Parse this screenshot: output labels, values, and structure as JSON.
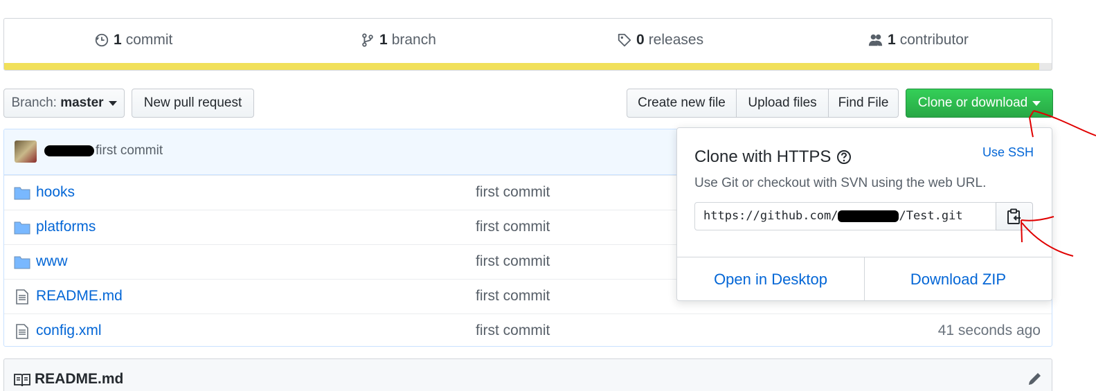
{
  "summary": {
    "commits": {
      "count": "1",
      "label": "commit"
    },
    "branches": {
      "count": "1",
      "label": "branch"
    },
    "releases": {
      "count": "0",
      "label": "releases"
    },
    "contributors": {
      "count": "1",
      "label": "contributor"
    },
    "language_color": "#f1e05a"
  },
  "toolbar": {
    "branch_prefix": "Branch:",
    "branch_name": "master",
    "new_pull_request": "New pull request",
    "create_new_file": "Create new file",
    "upload_files": "Upload files",
    "find_file": "Find File",
    "clone_or_download": "Clone or download"
  },
  "latest_commit": {
    "message": "first commit"
  },
  "files": [
    {
      "name": "hooks",
      "type": "folder",
      "message": "first commit",
      "age": ""
    },
    {
      "name": "platforms",
      "type": "folder",
      "message": "first commit",
      "age": ""
    },
    {
      "name": "www",
      "type": "folder",
      "message": "first commit",
      "age": ""
    },
    {
      "name": "README.md",
      "type": "file",
      "message": "first commit",
      "age": ""
    },
    {
      "name": "config.xml",
      "type": "file",
      "message": "first commit",
      "age": "41 seconds ago"
    }
  ],
  "readme": {
    "title": "README.md"
  },
  "clone_popover": {
    "title": "Clone with HTTPS",
    "use_ssh": "Use SSH",
    "description": "Use Git or checkout with SVN using the web URL.",
    "url_prefix": "https://github.com/",
    "url_suffix": "/Test.git",
    "open_in_desktop": "Open in Desktop",
    "download_zip": "Download ZIP"
  },
  "colors": {
    "primary_green": "#28a745",
    "link_blue": "#0366d6",
    "annotation_red": "#e00000"
  }
}
